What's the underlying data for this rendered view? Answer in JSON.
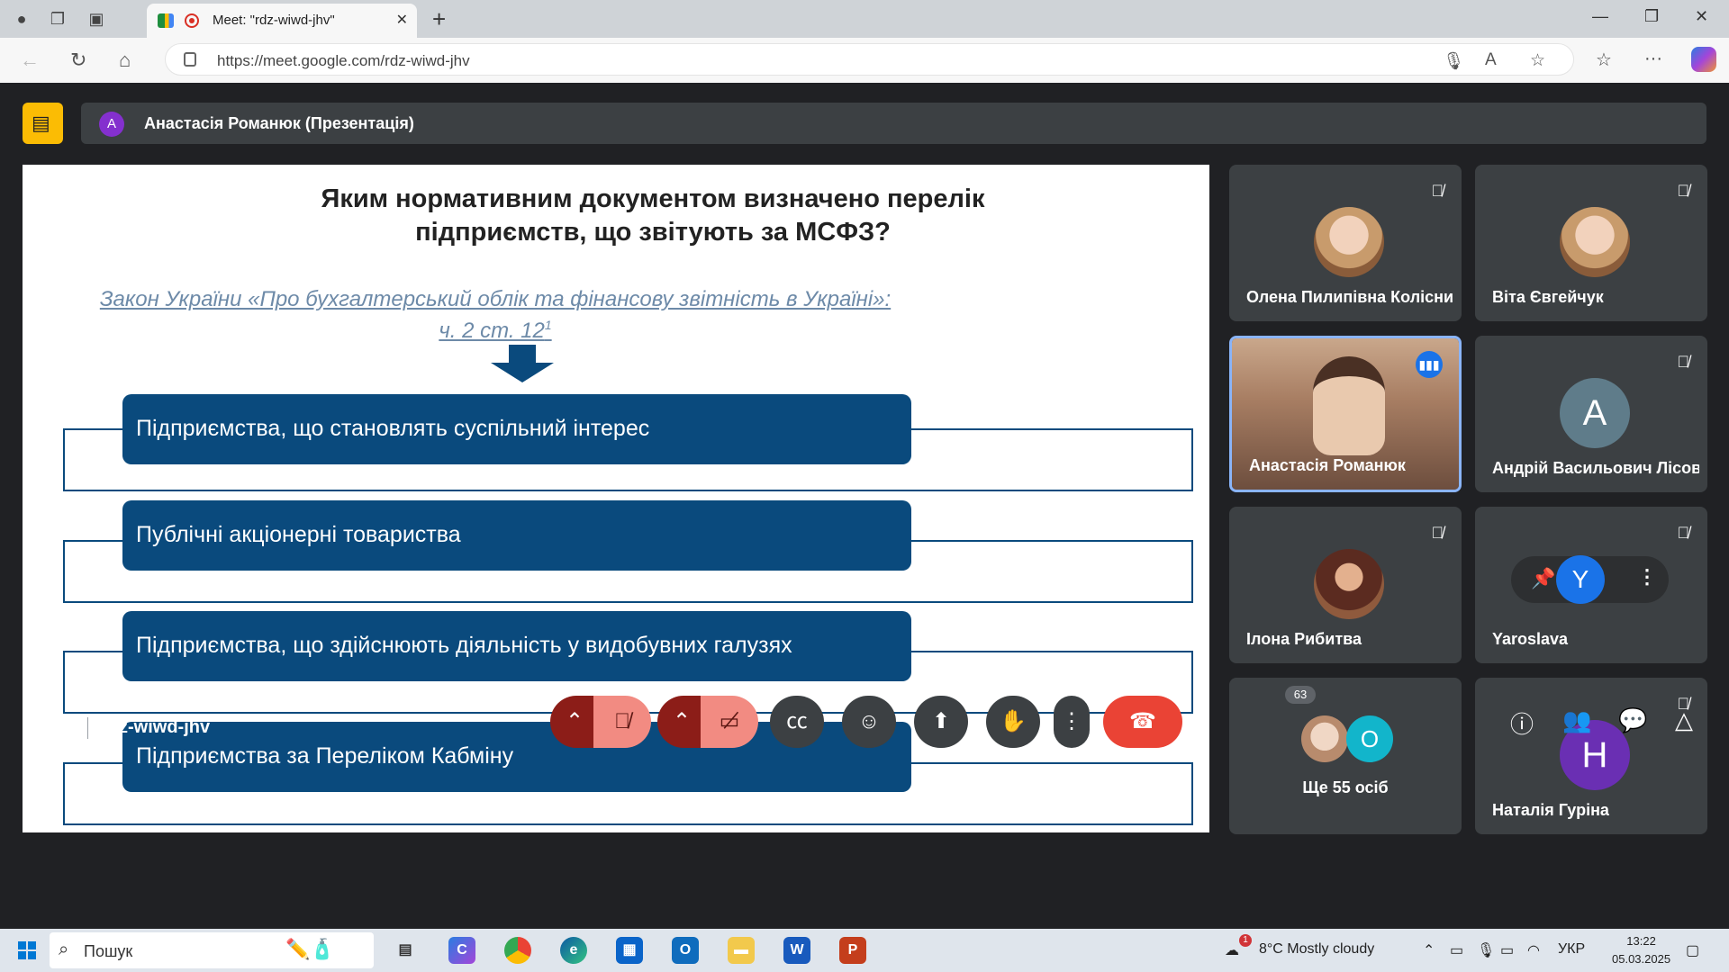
{
  "browser": {
    "tab_title": "Meet: \"rdz-wiwd-jhv\"",
    "url": "https://meet.google.com/rdz-wiwd-jhv"
  },
  "meet": {
    "presenter_initial": "A",
    "presenter_label": "Анастасія Романюк (Презентація)",
    "slide": {
      "title_line1": "Яким нормативним документом визначено перелік",
      "title_line2": "підприємств, що звітують за МСФЗ?",
      "law_line1": "Закон України «Про бухгалтерський облік та фінансову звітність в Україні»:",
      "law_line2": "ч. 2 ст. 12",
      "law_sup": "1",
      "items": [
        "Підприємства, що становлять суспільний інтерес",
        "Публічні акціонерні товариства",
        "Підприємства, що здійснюють діяльність  у видобувних галузях",
        "Підприємства за Переліком Кабміну"
      ]
    },
    "participants": [
      {
        "name": "Олена Пилипівна Колісник"
      },
      {
        "name": "Віта Євгейчук"
      },
      {
        "name": "Анастасія Романюк"
      },
      {
        "name": "Андрій Васильович Лісовий",
        "initial": "A"
      },
      {
        "name": "Ілона Рибитва"
      },
      {
        "name": "Yaroslava",
        "initial": "Y"
      },
      {
        "name": "Ще 55 осіб",
        "initial": "O"
      },
      {
        "name": "Наталія Гуріна",
        "initial": "Н"
      }
    ],
    "time": "13:22",
    "meeting_code": "rdz-wiwd-jhv",
    "people_count": "63"
  },
  "taskbar": {
    "search_placeholder": "Пошук",
    "weather": "8°C  Mostly cloudy",
    "weather_alert": "1",
    "lang": "УКР",
    "clock_time": "13:22",
    "clock_date": "05.03.2025"
  },
  "colors": {
    "slide_blue": "#0a4a7d",
    "end_call": "#ea4335",
    "mic_off": "#f28b82",
    "present_badge": "#fbbc04"
  }
}
